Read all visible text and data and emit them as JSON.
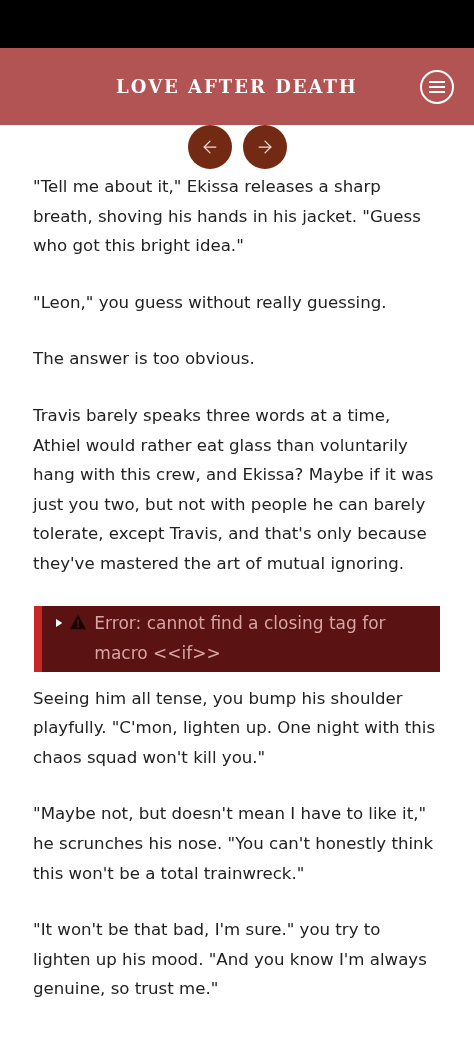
{
  "header": {
    "title": "LOVE AFTER DEATH"
  },
  "passage": [
    {
      "kind": "text",
      "text": "\"Tell me about it,\" Ekissa releases a sharp breath, shoving his hands in his jacket. \"Guess who got this bright idea.\""
    },
    {
      "kind": "text",
      "text": "\"Leon,\" you guess without really guessing."
    },
    {
      "kind": "text",
      "text": "The answer is too obvious."
    },
    {
      "kind": "text",
      "text": "Travis barely speaks three words at a time, Athiel would rather eat glass than voluntarily hang with this crew, and Ekissa? Maybe if it was just you two, but not with people he can barely tolerate, except Travis, and that's only because they've mastered the art of mutual ignoring."
    },
    {
      "kind": "error",
      "text": "Error: cannot find a closing tag for macro <<if>>",
      "expanded": false
    },
    {
      "kind": "text",
      "text": "Seeing him all tense, you bump his shoulder playfully. \"C'mon, lighten up. One night with this chaos squad won't kill you.\""
    },
    {
      "kind": "text",
      "text": "\"Maybe not, but doesn't mean I have to like it,\" he scrunches his nose. \"You can't honestly think this won't be a total trainwreck.\""
    },
    {
      "kind": "text",
      "text": "\"It won't be that bad, I'm sure.\" you try to lighten up his mood. \"And you know I'm always genuine, so trust me.\""
    }
  ]
}
